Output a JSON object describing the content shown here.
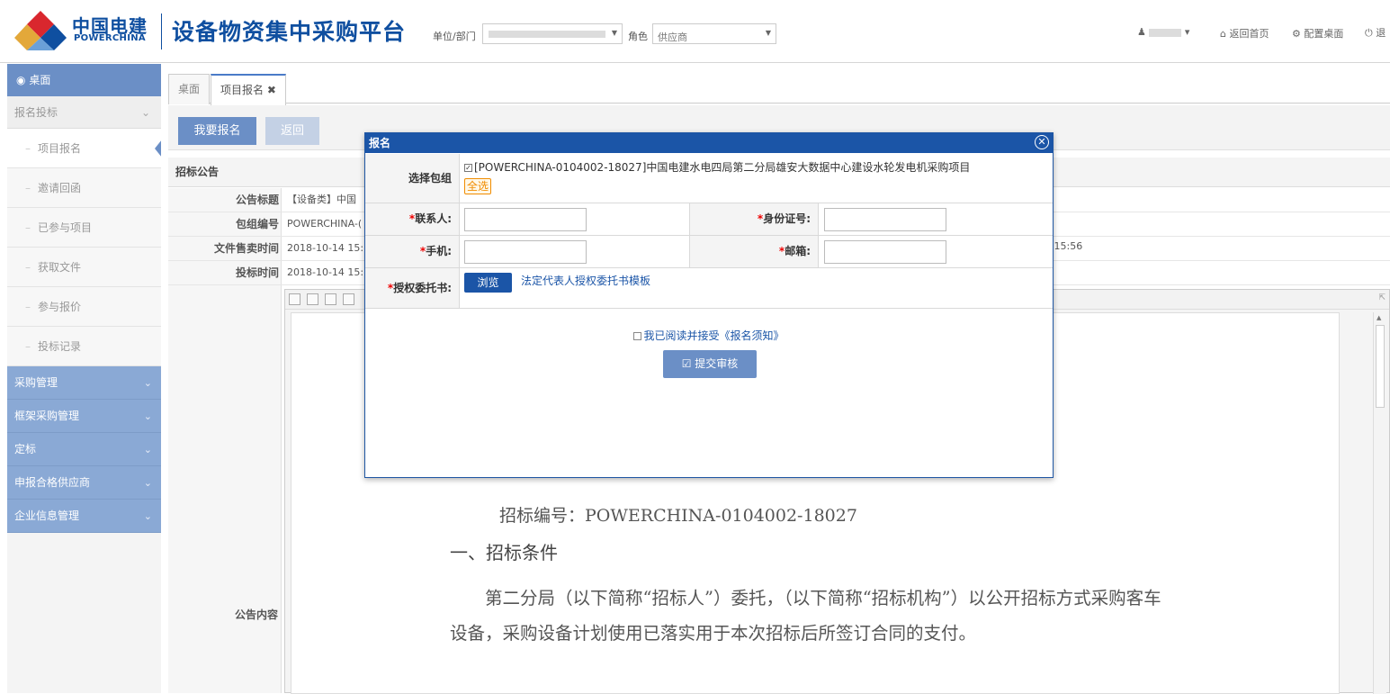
{
  "header": {
    "logo_cn": "中国电建",
    "logo_en": "POWERCHINA",
    "platform_title": "设备物资集中采购平台",
    "unit_label": "单位/部门",
    "role_label": "角色",
    "role_value": "供应商",
    "home_link": "返回首页",
    "config_link": "配置桌面",
    "logout_link": "退"
  },
  "sidebar": {
    "desk": "桌面",
    "section_baoming": "报名投标",
    "sub_items": [
      "项目报名",
      "邀请回函",
      "已参与项目",
      "获取文件",
      "参与报价",
      "投标记录"
    ],
    "sections": [
      "采购管理",
      "框架采购管理",
      "定标",
      "申报合格供应商",
      "企业信息管理"
    ]
  },
  "tabs": [
    "桌面",
    "项目报名"
  ],
  "toolbar": {
    "apply": "我要报名",
    "back": "返回"
  },
  "notice": {
    "header": "招标公告",
    "rows": [
      {
        "label": "公告标题",
        "value": "【设备类】中国"
      },
      {
        "label": "包组编号",
        "value": "POWERCHINA-("
      },
      {
        "label": "文件售卖时间",
        "value": "2018-10-14 15:"
      },
      {
        "label": "投标时间",
        "value": "2018-10-14 15:"
      }
    ],
    "sale_extra": "3 15:56",
    "content_label": "公告内容"
  },
  "doc": {
    "bid_no": "招标编号：POWERCHINA-0104002-18027",
    "heading": "一、招标条件",
    "para": "第二分局（以下简称“招标人”）委托，（以下简称“招标机构”）以公开招标方式采购客车设备，采购设备计划使用已落实用于本次招标后所签订合同的支付。"
  },
  "modal": {
    "title": "报名",
    "pkg_label": "选择包组",
    "pkg_option": "[POWERCHINA-0104002-18027]中国电建水电四局第二分局雄安大数据中心建设水轮发电机采购项目",
    "select_all": "全选",
    "contact_label": "联系人:",
    "id_label": "身份证号:",
    "phone_label": "手机:",
    "email_label": "邮箱:",
    "auth_label": "授权委托书:",
    "browse": "浏览",
    "template_link": "法定代表人授权委托书模板",
    "agree_text": "我已阅读并接受《报名须知》",
    "submit": "提交审核",
    "req_mark": "*"
  }
}
